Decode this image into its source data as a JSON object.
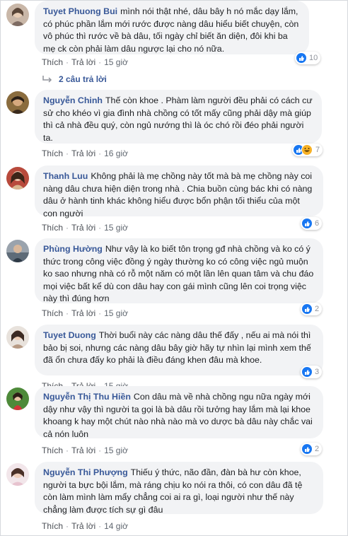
{
  "colors": {
    "name": "#385898",
    "bubble": "#f2f3f5",
    "like": "#1877f2",
    "haha": "#f7b125"
  },
  "actions": {
    "like": "Thích",
    "reply": "Trả lời",
    "sep": "·"
  },
  "comments": [
    {
      "name": "Tuyet Phuong Bui",
      "text": "mình nói thật nhé, dâu bây h nó mắc dạy lắm, có phúc phần lắm mới rước được nàng dâu hiểu biết chuyện, còn vô phúc thì rước về bà dâu, tối ngày chỉ biết ăn diện, đôi khi ba mẹ ck còn phải làm dâu ngược lại cho nó nữa.",
      "time": "15 giờ",
      "reactions": "10",
      "reaction_icons": [
        "like-icon"
      ],
      "replies_label": "2 câu trả lời"
    },
    {
      "name": "Nguyễn Chinh",
      "text": "Thế còn khoe . Phàm làm người đều phải có cách cư sử cho khéo vì gia đình nhà chồng có tốt mấy cũng phải dậy mà giúp thì cả nhà đều quý, còn ngủ nướng thì là óc chó rồi đéo phải người ta.",
      "time": "16 giờ",
      "reactions": "7",
      "reaction_icons": [
        "like-icon",
        "haha-icon"
      ]
    },
    {
      "name": "Thanh Luu",
      "text": "Không phải là mẹ chồng này tốt mà bà mẹ chồng này coi nàng dâu chưa hiện diện trong nhà . Chia buồn cùng bác khi có nàng dâu ở hành tinh khác không hiểu được bổn phận tối thiểu của một con người",
      "time": "15 giờ",
      "reactions": "6",
      "reaction_icons": [
        "like-icon"
      ]
    },
    {
      "name": "Phùng Hường",
      "text": "Như vậy là ko biết tôn trọng gđ nhà chồng và ko có ý thức trong công việc đồng ý ngày thường ko có công việc ngủ muộn ko sao nhưng nhà có rỗ một năm có một lần lên quan tâm và chu đáo mọi việc bất kể dù con dâu hay con gái mình cũng lên coi trọng việc này thì đúng hơn",
      "time": "15 giờ",
      "reactions": "2",
      "reaction_icons": [
        "like-icon"
      ]
    },
    {
      "name": "Tuyet Duong",
      "text": "Thời buổi này các nàng dâu thế đấy , nếu ai mà nói thì bảo bị soi, nhưng các nàng dâu bây giờ hãy tự nhìn lại mình xem thế đã ổn chưa đấy ko phải là điều đáng khen đâu mà khoe.",
      "time": "15 giờ",
      "reactions": "3",
      "reaction_icons": [
        "like-icon"
      ]
    },
    {
      "name": "Nguyễn Thị Thu Hiền",
      "text": "Con dâu mà về nhà chồng ngu nữa ngày mới dậy như vậy thì người ta gọi là bà dâu rồi tưởng hay lắm mà lại khoe khoang k hay một chút nào nhà nào mà vo dược bà dâu này chắc vai cả nón luôn",
      "time": "15 giờ",
      "reactions": "2",
      "reaction_icons": [
        "like-icon"
      ]
    },
    {
      "name": "Nguyễn Thi Phượng",
      "text": "Thiếu ý thức, não đần, đàn bà hư còn khoe, người ta bực bội lắm, mà ráng chịu ko nói ra thôi, có con dâu đã tệ còn làm mình làm mẩy chẳng coi ai ra gì, loại người như thế này chẳng làm được tích sự gì đâu",
      "time": "14 giờ",
      "reactions": "",
      "reaction_icons": []
    }
  ]
}
